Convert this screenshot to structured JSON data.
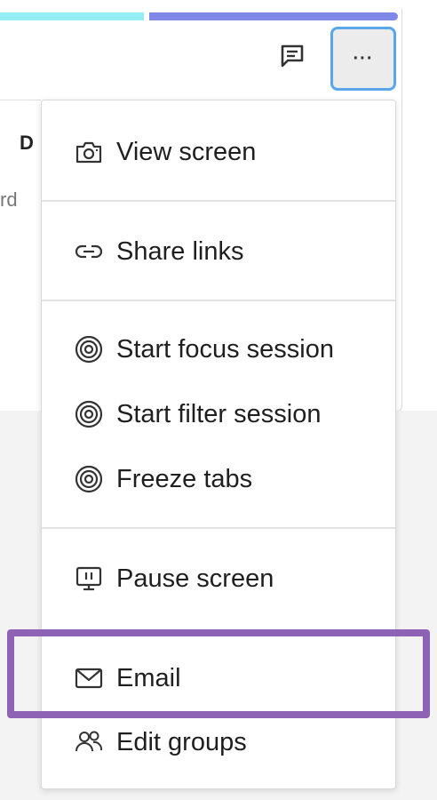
{
  "background": {
    "peek_heading": "D",
    "peek_text": "rd",
    "progress_bars": [
      {
        "color": "#92eef3"
      },
      {
        "color": "#7f87e8"
      }
    ]
  },
  "toolbar": {
    "chat_icon": "chat-icon",
    "more_label": "···",
    "more_border_color": "#5aa6ea"
  },
  "menu": {
    "items": [
      {
        "label": "View screen",
        "icon": "camera-icon"
      },
      {
        "label": "Share links",
        "icon": "link-icon"
      },
      {
        "label": "Start focus session",
        "icon": "target-icon"
      },
      {
        "label": "Start filter session",
        "icon": "target-icon"
      },
      {
        "label": "Freeze tabs",
        "icon": "target-icon"
      },
      {
        "label": "Pause screen",
        "icon": "pause-screen-icon"
      },
      {
        "label": "Email",
        "icon": "mail-icon"
      },
      {
        "label": "Edit groups",
        "icon": "people-icon"
      }
    ],
    "highlight_color": "#8e62b5"
  }
}
